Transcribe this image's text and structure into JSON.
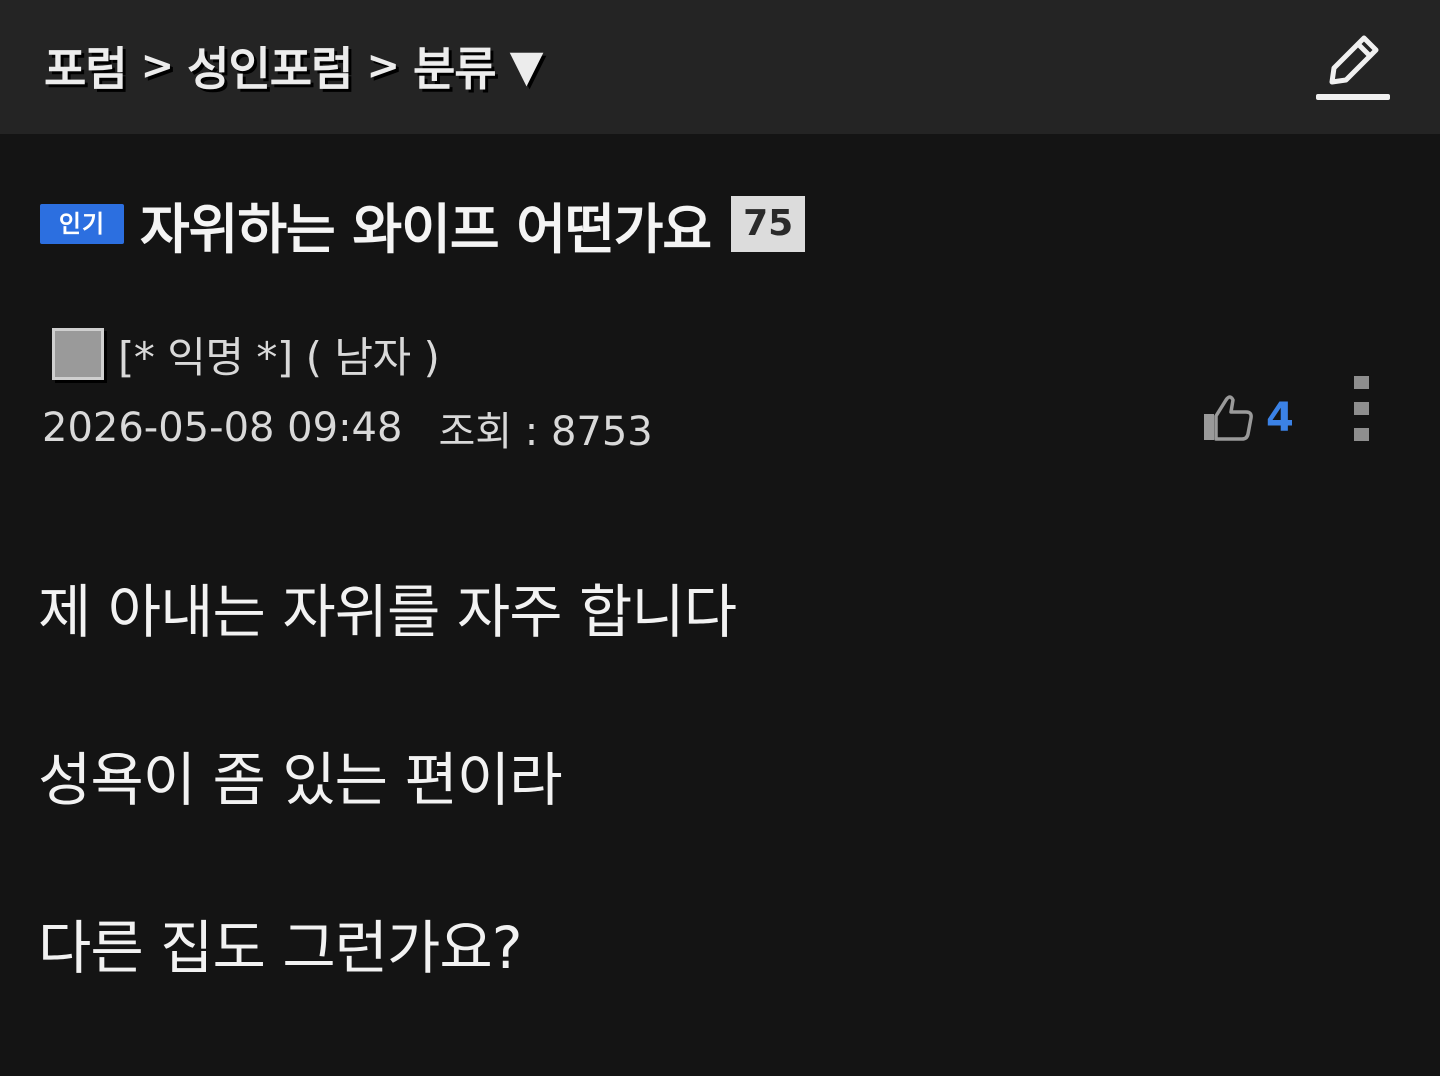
{
  "breadcrumb": {
    "items": [
      "포럼",
      "성인포럼",
      "분류"
    ],
    "separator": ">",
    "dropdown_caret": "▼"
  },
  "header": {
    "write_icon": "pencil-icon"
  },
  "post": {
    "badge": "인기",
    "title": "자위하는 와이프 어떤가요",
    "comment_count": "75",
    "author": "[* 익명 *] ( 남자 )",
    "date": "2026-05-08 09:48",
    "views_label": "조회 : 8753",
    "likes": "4",
    "body": [
      "제 아내는 자위를 자주 합니다",
      "성욕이 좀 있는 편이라",
      "다른 집도 그런가요?"
    ]
  },
  "colors": {
    "background": "#141414",
    "topbar": "#242424",
    "badge": "#2c6fe0",
    "like_accent": "#3b82e6"
  },
  "icons": {
    "like": "thumbs-up-icon",
    "more": "more-vertical-icon",
    "avatar": "avatar-square"
  }
}
